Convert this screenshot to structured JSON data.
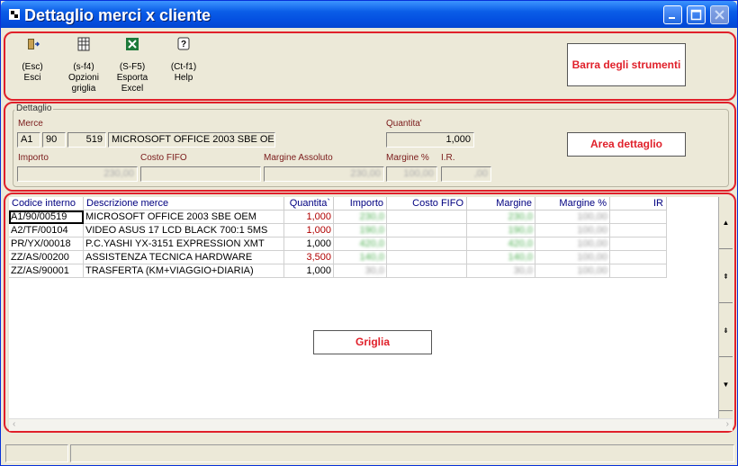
{
  "window": {
    "title": "Dettaglio merci x cliente"
  },
  "toolbar": {
    "buttons": [
      {
        "shortcut": "(Esc)",
        "label": "Esci",
        "icon": "exit-door-icon"
      },
      {
        "shortcut": "(s-f4)",
        "label": "Opzioni griglia",
        "icon": "grid-options-icon"
      },
      {
        "shortcut": "(S-F5)",
        "label": "Esporta Excel",
        "icon": "excel-icon"
      },
      {
        "shortcut": "(Ct-f1)",
        "label": "Help",
        "icon": "help-icon"
      }
    ],
    "callout": "Barra degli strumenti"
  },
  "detail": {
    "legend": "Dettaglio",
    "merce_label": "Merce",
    "merce_code1": "A1",
    "merce_code2": "90",
    "merce_code3": "519",
    "merce_desc": "MICROSOFT OFFICE 2003 SBE OEM",
    "quantita_label": "Quantita'",
    "quantita_value": "1,000",
    "importo_label": "Importo",
    "importo_value": "230,00",
    "costo_fifo_label": "Costo FIFO",
    "costo_fifo_value": "",
    "margine_assoluto_label": "Margine Assoluto",
    "margine_assoluto_value": "230,00",
    "margine_pct_label": "Margine %",
    "margine_pct_value": "100,00",
    "ir_label": "I.R.",
    "ir_value": ",00",
    "callout": "Area dettaglio"
  },
  "grid": {
    "columns": [
      "Codice interno",
      "Descrizione merce",
      "Quantita`",
      "Importo",
      "Costo FIFO",
      "Margine",
      "Margine %",
      "IR"
    ],
    "rows": [
      {
        "codice": "A1/90/00519",
        "descrizione": "MICROSOFT OFFICE 2003 SBE OEM",
        "quantita": "1,000",
        "importo": "230,0",
        "costo": "",
        "margine": "230,0",
        "margine_pct": "100,00",
        "ir": ""
      },
      {
        "codice": "A2/TF/00104",
        "descrizione": "VIDEO ASUS 17 LCD  BLACK 700:1 5MS",
        "quantita": "1,000",
        "importo": "190,0",
        "costo": "",
        "margine": "190,0",
        "margine_pct": "100,00",
        "ir": ""
      },
      {
        "codice": "PR/YX/00018",
        "descrizione": "P.C.YASHI YX-3151 EXPRESSION XMT",
        "quantita": "1,000",
        "importo": "420,0",
        "costo": "",
        "margine": "420,0",
        "margine_pct": "100,00",
        "ir": ""
      },
      {
        "codice": "ZZ/AS/00200",
        "descrizione": "ASSISTENZA TECNICA HARDWARE",
        "quantita": "3,500",
        "importo": "140,0",
        "costo": "",
        "margine": "140,0",
        "margine_pct": "100,00",
        "ir": ""
      },
      {
        "codice": "ZZ/AS/90001",
        "descrizione": "TRASFERTA (KM+VIAGGIO+DIARIA)",
        "quantita": "1,000",
        "importo": "30,0",
        "costo": "",
        "margine": "30,0",
        "margine_pct": "100,00",
        "ir": ""
      }
    ],
    "callout": "Griglia"
  }
}
